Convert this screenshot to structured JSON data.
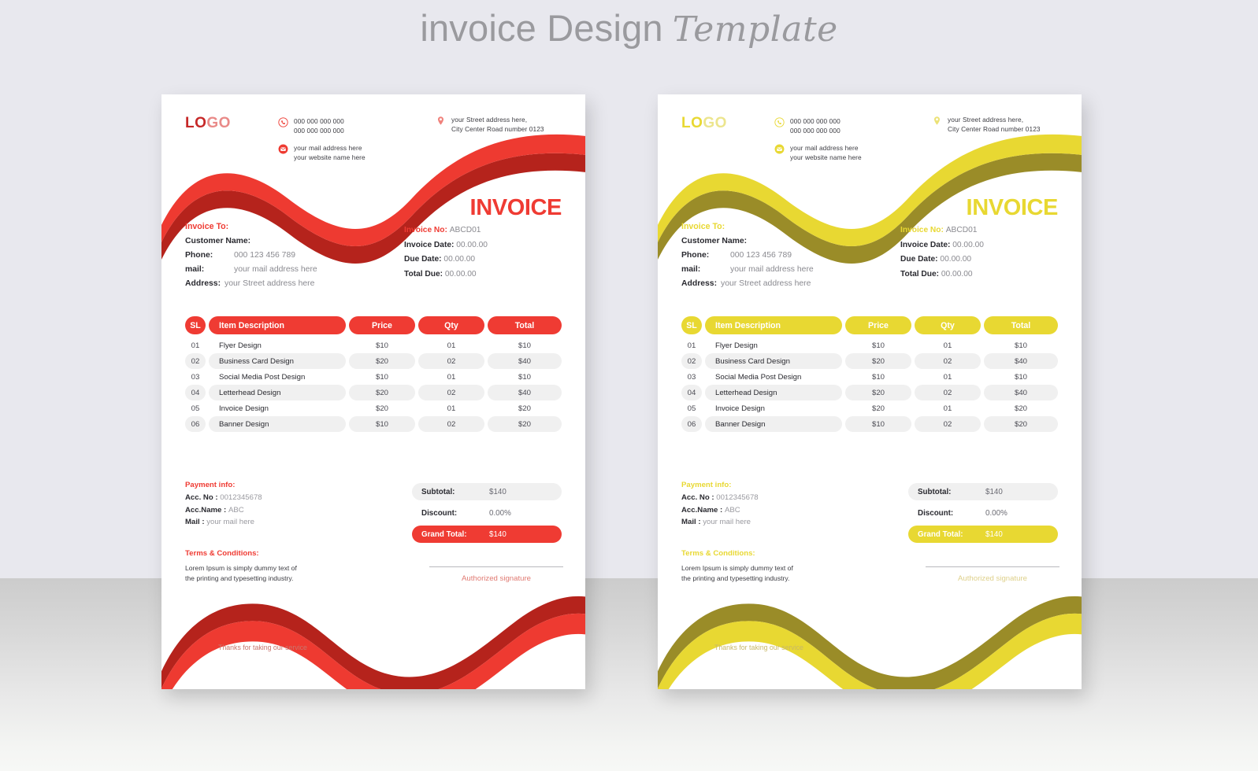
{
  "headline": {
    "main": "invoice Design",
    "script": "Template"
  },
  "colors": {
    "red_accent": "#ef3b33",
    "red_dark": "#b5231c",
    "yellow_accent": "#e8d832",
    "yellow_dark": "#9a8c28",
    "wall": "#e8e8ee",
    "shelf": "#d4d4d4",
    "row_shade": "#f0f0f0"
  },
  "invoice": {
    "logo": {
      "part1": "LO",
      "part2": "GO"
    },
    "contacts": {
      "phone": {
        "icon": "phone-icon",
        "line1": "000 000 000 000",
        "line2": "000 000 000 000"
      },
      "mail": {
        "icon": "mail-icon",
        "line1": "your mail address here",
        "line2": "your website name here"
      },
      "address": {
        "icon": "location-pin-icon",
        "line1": "your Street address here,",
        "line2": "City Center Road number 0123"
      }
    },
    "title": "INVOICE",
    "bill_to": {
      "heading": "Invoice To:",
      "customer_label": "Customer Name:",
      "rows": [
        {
          "label": "Phone:",
          "value": "000 123 456 789"
        },
        {
          "label": "mail:",
          "value": "your mail address here"
        },
        {
          "label": "Address:",
          "value": "your Street address here"
        }
      ]
    },
    "meta": [
      {
        "label": "Invoice No:",
        "value": "ABCD01",
        "accent": true
      },
      {
        "label": "Invoice Date:",
        "value": "00.00.00",
        "accent": false
      },
      {
        "label": "Due Date:",
        "value": "00.00.00",
        "accent": false
      },
      {
        "label": "Total Due:",
        "value": "00.00.00",
        "accent": false
      }
    ],
    "table": {
      "headers": [
        "SL",
        "Item Description",
        "Price",
        "Qty",
        "Total"
      ],
      "rows": [
        {
          "sl": "01",
          "desc": "Flyer Design",
          "price": "$10",
          "qty": "01",
          "total": "$10"
        },
        {
          "sl": "02",
          "desc": "Business Card Design",
          "price": "$20",
          "qty": "02",
          "total": "$40"
        },
        {
          "sl": "03",
          "desc": "Social Media Post Design",
          "price": "$10",
          "qty": "01",
          "total": "$10"
        },
        {
          "sl": "04",
          "desc": "Letterhead Design",
          "price": "$20",
          "qty": "02",
          "total": "$40"
        },
        {
          "sl": "05",
          "desc": "Invoice Design",
          "price": "$20",
          "qty": "01",
          "total": "$20"
        },
        {
          "sl": "06",
          "desc": "Banner Design",
          "price": "$10",
          "qty": "02",
          "total": "$20"
        }
      ]
    },
    "payment_info": {
      "heading": "Payment info:",
      "rows": [
        {
          "label": "Acc. No :",
          "value": "0012345678"
        },
        {
          "label": "Acc.Name :",
          "value": "ABC"
        },
        {
          "label": "Mail :",
          "value": "your mail here"
        }
      ]
    },
    "terms": {
      "heading": "Terms & Conditions:",
      "line1": "Lorem Ipsum is simply dummy text of",
      "line2": "the printing and typesetting industry."
    },
    "totals": [
      {
        "label": "Subtotal:",
        "value": "$140",
        "style": "shaded"
      },
      {
        "label": "Discount:",
        "value": "0.00%",
        "style": "plain"
      },
      {
        "label": "Grand Total:",
        "value": "$140",
        "style": "grand"
      }
    ],
    "signature_label": "Authorized signature",
    "thanks": "Thanks for taking our service"
  }
}
